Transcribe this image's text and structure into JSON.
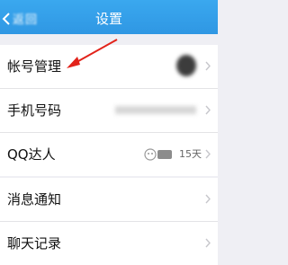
{
  "header": {
    "back_label": "返回",
    "title": "设置"
  },
  "groups": [
    {
      "items": [
        {
          "label": "帐号管理"
        },
        {
          "label": "手机号码"
        },
        {
          "label": "QQ达人",
          "value": "15天"
        }
      ]
    },
    {
      "items": [
        {
          "label": "消息通知"
        },
        {
          "label": "聊天记录"
        }
      ]
    }
  ],
  "colors": {
    "header": "#2f97e3",
    "annotation_arrow": "#e2231a"
  }
}
